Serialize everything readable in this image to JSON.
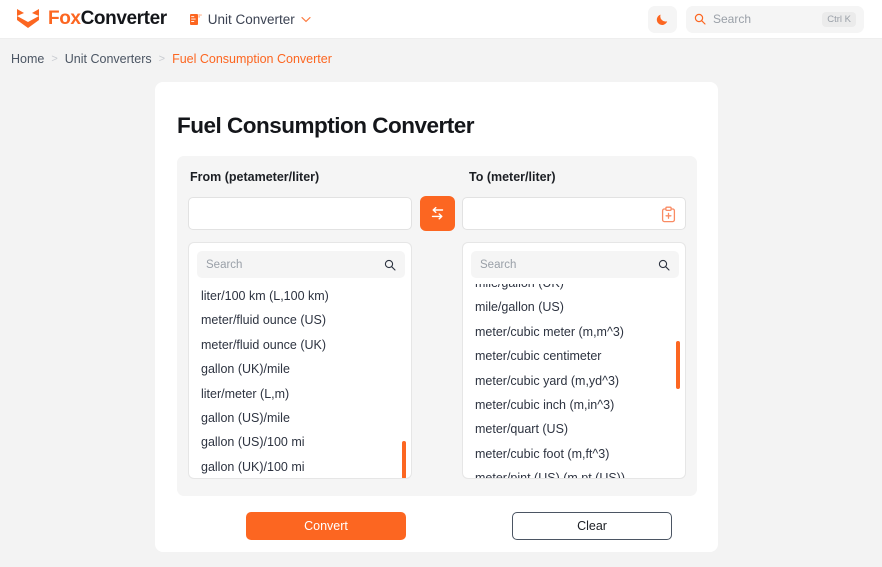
{
  "theme": {
    "accent": "#fc6621",
    "page_bg": "#f3f3f3",
    "card_bg": "#ffffff",
    "panel_bg": "#f5f5f5"
  },
  "header": {
    "brand_first": "Fox",
    "brand_second": "Converter",
    "logo_icon": "fox-logo-icon",
    "nav": {
      "icon": "ruler-icon",
      "label": "Unit Converter",
      "chevron": "chevron-down-icon"
    },
    "theme_toggle": {
      "icon": "moon-icon"
    },
    "search": {
      "icon": "search-icon",
      "placeholder": "Search",
      "shortcut": "Ctrl K"
    }
  },
  "breadcrumb": {
    "items": [
      {
        "label": "Home",
        "active": false
      },
      {
        "label": "Unit Converters",
        "active": false
      },
      {
        "label": "Fuel Consumption Converter",
        "active": true
      }
    ],
    "separator": ">"
  },
  "main": {
    "title": "Fuel Consumption Converter",
    "from": {
      "label": "From (petameter/liter)",
      "value": "",
      "placeholder": "",
      "search_placeholder": "Search",
      "search_icon": "search-icon",
      "units": [
        "liter/100 km (L,100 km)",
        "meter/fluid ounce (US)",
        "meter/fluid ounce (UK)",
        "gallon (UK)/mile",
        "liter/meter (L,m)",
        "gallon (US)/mile",
        "gallon (US)/100 mi",
        "gallon (UK)/100 mi"
      ]
    },
    "to": {
      "label": "To (meter/liter)",
      "value": "",
      "placeholder": "",
      "copy_icon": "clipboard-plus-icon",
      "search_placeholder": "Search",
      "search_icon": "search-icon",
      "units": [
        "mile/gallon (UK)",
        "mile/gallon (US)",
        "meter/cubic meter (m,m^3)",
        "meter/cubic centimeter",
        "meter/cubic yard (m,yd^3)",
        "meter/cubic inch (m,in^3)",
        "meter/quart (US)",
        "meter/cubic foot (m,ft^3)",
        "meter/pint (US) (m,pt (US))"
      ]
    },
    "swap": {
      "icon": "swap-arrows-icon",
      "label": ""
    },
    "convert_label": "Convert",
    "clear_label": "Clear"
  }
}
